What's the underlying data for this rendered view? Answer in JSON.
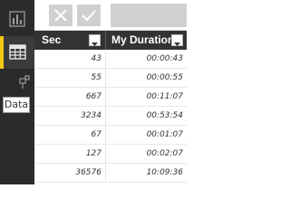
{
  "viewbar": {
    "buttons": [
      {
        "name": "report-view",
        "icon": "bar-chart-icon"
      },
      {
        "name": "data-view",
        "icon": "table-grid-icon",
        "active": true
      },
      {
        "name": "model-view",
        "icon": "relationship-icon"
      }
    ],
    "tooltip": "Data",
    "accent_color": "#f2c811"
  },
  "formula_bar": {
    "cancel_icon": "close-icon",
    "commit_icon": "check-icon"
  },
  "table": {
    "columns": [
      "Sec",
      "My Duration"
    ],
    "rows": [
      {
        "sec": "43",
        "duration": "00:00:43"
      },
      {
        "sec": "55",
        "duration": "00:00:55"
      },
      {
        "sec": "667",
        "duration": "00:11:07"
      },
      {
        "sec": "3234",
        "duration": "00:53:54"
      },
      {
        "sec": "67",
        "duration": "00:01:07"
      },
      {
        "sec": "127",
        "duration": "00:02:07"
      },
      {
        "sec": "36576",
        "duration": "10:09:36"
      }
    ]
  }
}
